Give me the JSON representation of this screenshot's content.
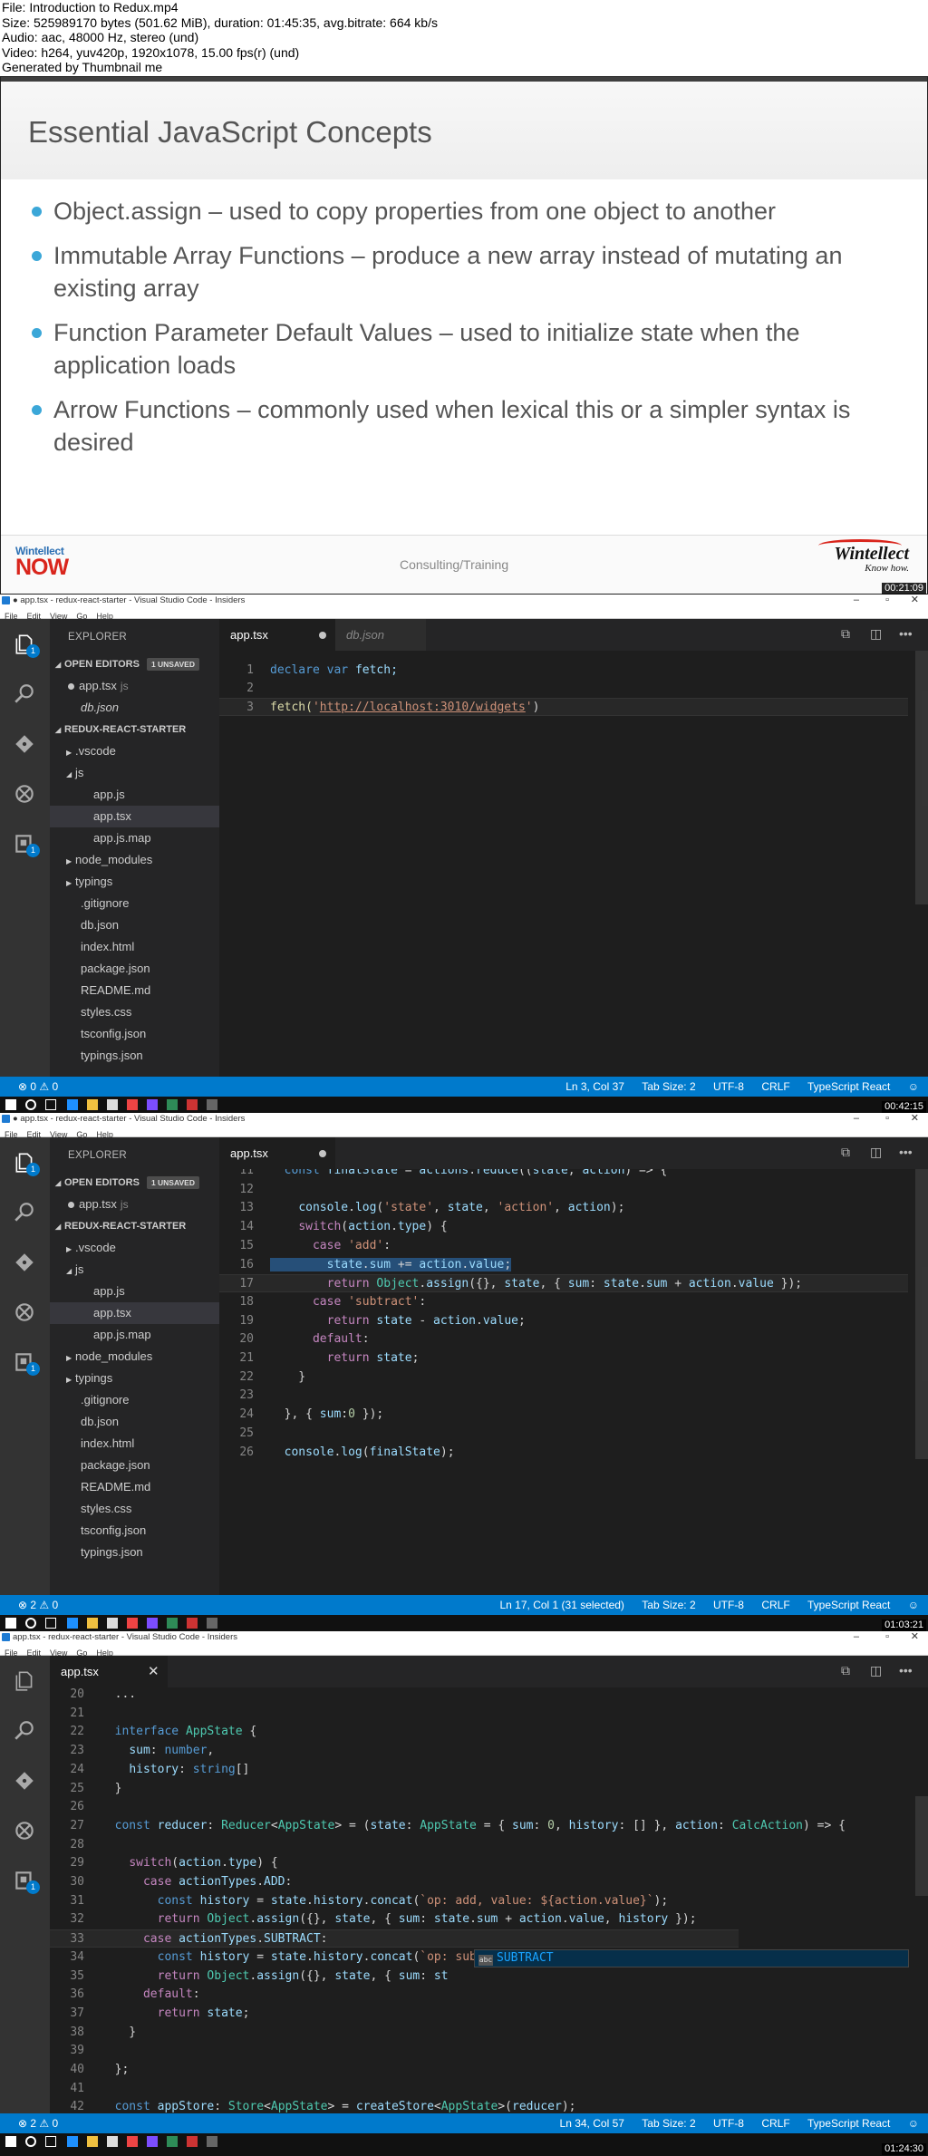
{
  "header": {
    "lines": [
      "File: Introduction to Redux.mp4",
      "Size: 525989170 bytes (501.62 MiB), duration: 01:45:35, avg.bitrate: 664 kb/s",
      "Audio: aac, 48000 Hz, stereo (und)",
      "Video: h264, yuv420p, 1920x1078, 15.00 fps(r) (und)",
      "Generated by Thumbnail me"
    ]
  },
  "slide": {
    "title": "Essential JavaScript Concepts",
    "bullets": [
      "Object.assign – used to copy properties from one object to another",
      "Immutable Array Functions – produce a new array instead of mutating an existing array",
      "Function Parameter Default Values – used to initialize state when the application loads",
      "Arrow Functions – commonly used when lexical this or a simpler syntax is desired"
    ],
    "logo_left_top": "Wintellect",
    "logo_left_bottom": "NOW",
    "footer_center": "Consulting/Training",
    "logo_right_top": "Wintellect",
    "logo_right_bottom": "Know how.",
    "timestamp": "00:21:09"
  },
  "frame2": {
    "title": "● app.tsx - redux-react-starter - Visual Studio Code - Insiders",
    "menu": [
      "File",
      "Edit",
      "View",
      "Go",
      "Help"
    ],
    "explorer": "EXPLORER",
    "open_editors": "OPEN EDITORS",
    "unsaved": "1 UNSAVED",
    "open_files": [
      {
        "name": "app.tsx",
        "sub": "js"
      },
      {
        "name": "db.json",
        "sub": ""
      }
    ],
    "project": "REDUX-REACT-STARTER",
    "tree": [
      ".vscode",
      "js",
      "app.js",
      "app.tsx",
      "app.js.map",
      "node_modules",
      "typings",
      ".gitignore",
      "db.json",
      "index.html",
      "package.json",
      "README.md",
      "styles.css",
      "tsconfig.json",
      "typings.json"
    ],
    "tabs": [
      "app.tsx",
      "db.json"
    ],
    "code": {
      "l1_kw1": "declare",
      "l1_kw2": "var",
      "l1_id": "fetch;",
      "l3_fn": "fetch(",
      "l3_q1": "'",
      "l3_url": "http://localhost:3010/widgets",
      "l3_q2": "'",
      "l3_end": ")"
    },
    "status_left": "⊗ 0 ⚠ 0",
    "status_right": [
      "Ln 3, Col 37",
      "Tab Size: 2",
      "UTF-8",
      "CRLF",
      "TypeScript React",
      "☺"
    ],
    "badge": "1",
    "timestamp": "00:42:15"
  },
  "frame3": {
    "title": "● app.tsx - redux-react-starter - Visual Studio Code - Insiders",
    "menu": [
      "File",
      "Edit",
      "View",
      "Go",
      "Help"
    ],
    "explorer": "EXPLORER",
    "open_editors": "OPEN EDITORS",
    "unsaved": "1 UNSAVED",
    "open_files": [
      {
        "name": "app.tsx",
        "sub": "js"
      }
    ],
    "project": "REDUX-REACT-STARTER",
    "tree": [
      ".vscode",
      "js",
      "app.js",
      "app.tsx",
      "app.js.map",
      "node_modules",
      "typings",
      ".gitignore",
      "db.json",
      "index.html",
      "package.json",
      "README.md",
      "styles.css",
      "tsconfig.json",
      "typings.json"
    ],
    "tabs": [
      "app.tsx"
    ],
    "lines": [
      {
        "n": "11",
        "t": "  const finalState = actions.reduce((state, action) => {"
      },
      {
        "n": "12",
        "t": ""
      },
      {
        "n": "13",
        "t": "    console.log('state', state, 'action', action);"
      },
      {
        "n": "14",
        "t": "    switch(action.type) {"
      },
      {
        "n": "15",
        "t": "      case 'add':"
      },
      {
        "n": "16",
        "t": "        state.sum += action.value;"
      },
      {
        "n": "17",
        "t": "        return Object.assign({}, state, { sum: state.sum + action.value });"
      },
      {
        "n": "18",
        "t": "      case 'subtract':"
      },
      {
        "n": "19",
        "t": "        return state - action.value;"
      },
      {
        "n": "20",
        "t": "      default:"
      },
      {
        "n": "21",
        "t": "        return state;"
      },
      {
        "n": "22",
        "t": "    }"
      },
      {
        "n": "23",
        "t": ""
      },
      {
        "n": "24",
        "t": "  }, { sum:0 });"
      },
      {
        "n": "25",
        "t": ""
      },
      {
        "n": "26",
        "t": "  console.log(finalState);"
      }
    ],
    "status_left": "⊗ 2 ⚠ 0",
    "status_right": [
      "Ln 17, Col 1 (31 selected)",
      "Tab Size: 2",
      "UTF-8",
      "CRLF",
      "TypeScript React",
      "☺"
    ],
    "badge": "1",
    "timestamp": "01:03:21"
  },
  "frame4": {
    "title": "app.tsx - redux-react-starter - Visual Studio Code - Insiders",
    "menu": [
      "File",
      "Edit",
      "View",
      "Go",
      "Help"
    ],
    "tabs": [
      "app.tsx"
    ],
    "lines": [
      {
        "n": "20",
        "t": "  ..."
      },
      {
        "n": "21",
        "t": ""
      },
      {
        "n": "22",
        "t": "  interface AppState {"
      },
      {
        "n": "23",
        "t": "    sum: number,"
      },
      {
        "n": "24",
        "t": "    history: string[]"
      },
      {
        "n": "25",
        "t": "  }"
      },
      {
        "n": "26",
        "t": ""
      },
      {
        "n": "27",
        "t": "  const reducer: Reducer<AppState> = (state: AppState = { sum: 0, history: [] }, action: CalcAction) => {"
      },
      {
        "n": "28",
        "t": ""
      },
      {
        "n": "29",
        "t": "    switch(action.type) {"
      },
      {
        "n": "30",
        "t": "      case actionTypes.ADD:"
      },
      {
        "n": "31",
        "t": "        const history = state.history.concat(`op: add, value: ${action.value}`);"
      },
      {
        "n": "32",
        "t": "        return Object.assign({}, state, { sum: state.sum + action.value, history });"
      },
      {
        "n": "33",
        "t": "      case actionTypes.SUBTRACT:"
      },
      {
        "n": "34",
        "t": "        const history = state.history.concat(`op: subtract, value: ${action.value}`);"
      },
      {
        "n": "35",
        "t": "        return Object.assign({}, state, { sum: st"
      },
      {
        "n": "36",
        "t": "      default:"
      },
      {
        "n": "37",
        "t": "        return state;"
      },
      {
        "n": "38",
        "t": "    }"
      },
      {
        "n": "39",
        "t": ""
      },
      {
        "n": "40",
        "t": "  };"
      },
      {
        "n": "41",
        "t": ""
      },
      {
        "n": "42",
        "t": "  const appStore: Store<AppState> = createStore<AppState>(reducer);"
      }
    ],
    "suggestion": "SUBTRACT",
    "suggestion_icon": "abc",
    "status_left": "⊗ 2 ⚠ 0",
    "status_right": [
      "Ln 34, Col 57",
      "Tab Size: 2",
      "UTF-8",
      "CRLF",
      "TypeScript React",
      "☺"
    ],
    "badge": "1",
    "timestamp": "01:24:30"
  },
  "colors": {
    "status_bar": "#007acc",
    "bullet": "#3ba7d8",
    "activity_bar": "#333333",
    "sidebar": "#252526",
    "editor": "#1e1e1e",
    "brand_red": "#d9251c"
  }
}
